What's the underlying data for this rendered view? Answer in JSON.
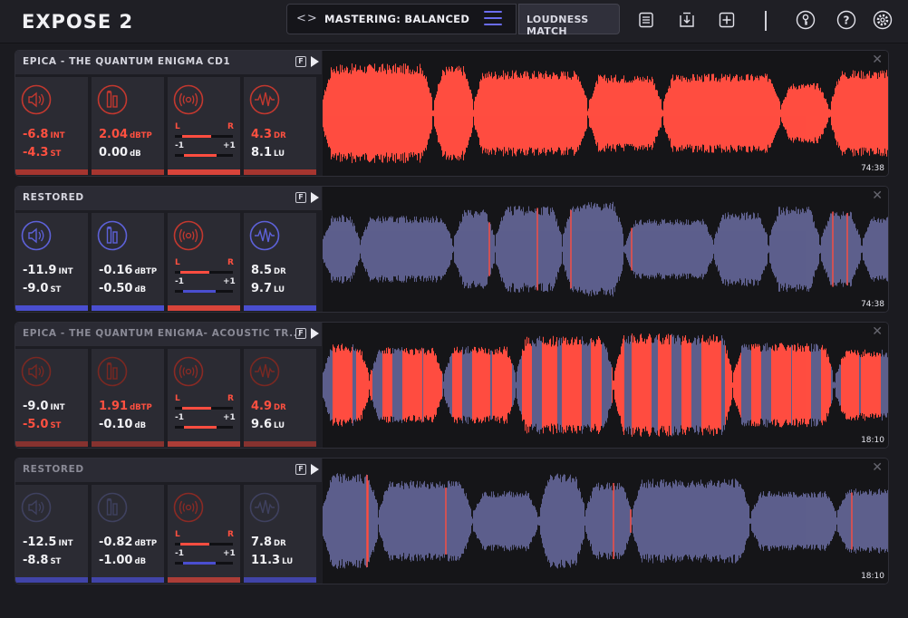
{
  "app": {
    "title": "EXPOSE 2"
  },
  "toolbar": {
    "preset_arrows": "<>",
    "preset_name": "MASTERING: BALANCED",
    "loudness_match": "LOUDNESS MATCH",
    "icons": [
      "list-icon",
      "download-icon",
      "add-icon",
      "key-icon",
      "help-icon",
      "settings-icon"
    ]
  },
  "colors": {
    "red": "#ff5040",
    "lavender": "#5b5e8a",
    "blue_bar": "#4448c8",
    "red_bar": "#a5352f"
  },
  "tracks": [
    {
      "name": "EPICA - THE QUANTUM ENIGMA CD1",
      "state": "active",
      "duration": "74:38",
      "waveform": "red",
      "loudness": {
        "int": "-6.8",
        "int_unit": "INT",
        "st": "-4.3",
        "st_unit": "ST"
      },
      "peak": {
        "dbtp": "2.04",
        "dbtp_unit": "dBTP",
        "db": "0.00",
        "db_unit": "dB"
      },
      "stereo": {
        "l": "L",
        "r": "R",
        "neg": "-1",
        "pos": "+1",
        "balance": 0.62,
        "correlation": 0.72
      },
      "dynamics": {
        "dr": "4.3",
        "dr_unit": "DR",
        "lu": "8.1",
        "lu_unit": "LU"
      }
    },
    {
      "name": "RESTORED",
      "state": "active",
      "duration": "74:38",
      "waveform": "lavender",
      "loudness": {
        "int": "-11.9",
        "int_unit": "INT",
        "st": "-9.0",
        "st_unit": "ST"
      },
      "peak": {
        "dbtp": "-0.16",
        "dbtp_unit": "dBTP",
        "db": "-0.50",
        "db_unit": "dB"
      },
      "stereo": {
        "l": "L",
        "r": "R",
        "neg": "-1",
        "pos": "+1",
        "balance": 0.6,
        "correlation": 0.7
      },
      "dynamics": {
        "dr": "8.5",
        "dr_unit": "DR",
        "lu": "9.7",
        "lu_unit": "LU"
      }
    },
    {
      "name": "EPICA - THE QUANTUM ENIGMA- ACOUSTIC TR...",
      "state": "inactive",
      "duration": "18:10",
      "waveform": "mixed",
      "loudness": {
        "int": "-9.0",
        "int_unit": "INT",
        "st": "-5.0",
        "st_unit": "ST"
      },
      "peak": {
        "dbtp": "1.91",
        "dbtp_unit": "dBTP",
        "db": "-0.10",
        "db_unit": "dB"
      },
      "stereo": {
        "l": "L",
        "r": "R",
        "neg": "-1",
        "pos": "+1",
        "balance": 0.62,
        "correlation": 0.72
      },
      "dynamics": {
        "dr": "4.9",
        "dr_unit": "DR",
        "lu": "9.6",
        "lu_unit": "LU"
      }
    },
    {
      "name": "RESTORED",
      "state": "inactive",
      "duration": "18:10",
      "waveform": "lavender",
      "loudness": {
        "int": "-12.5",
        "int_unit": "INT",
        "st": "-8.8",
        "st_unit": "ST"
      },
      "peak": {
        "dbtp": "-0.82",
        "dbtp_unit": "dBTP",
        "db": "-1.00",
        "db_unit": "dB"
      },
      "stereo": {
        "l": "L",
        "r": "R",
        "neg": "-1",
        "pos": "+1",
        "balance": 0.6,
        "correlation": 0.7
      },
      "dynamics": {
        "dr": "7.8",
        "dr_unit": "DR",
        "lu": "11.3",
        "lu_unit": "LU"
      }
    }
  ]
}
